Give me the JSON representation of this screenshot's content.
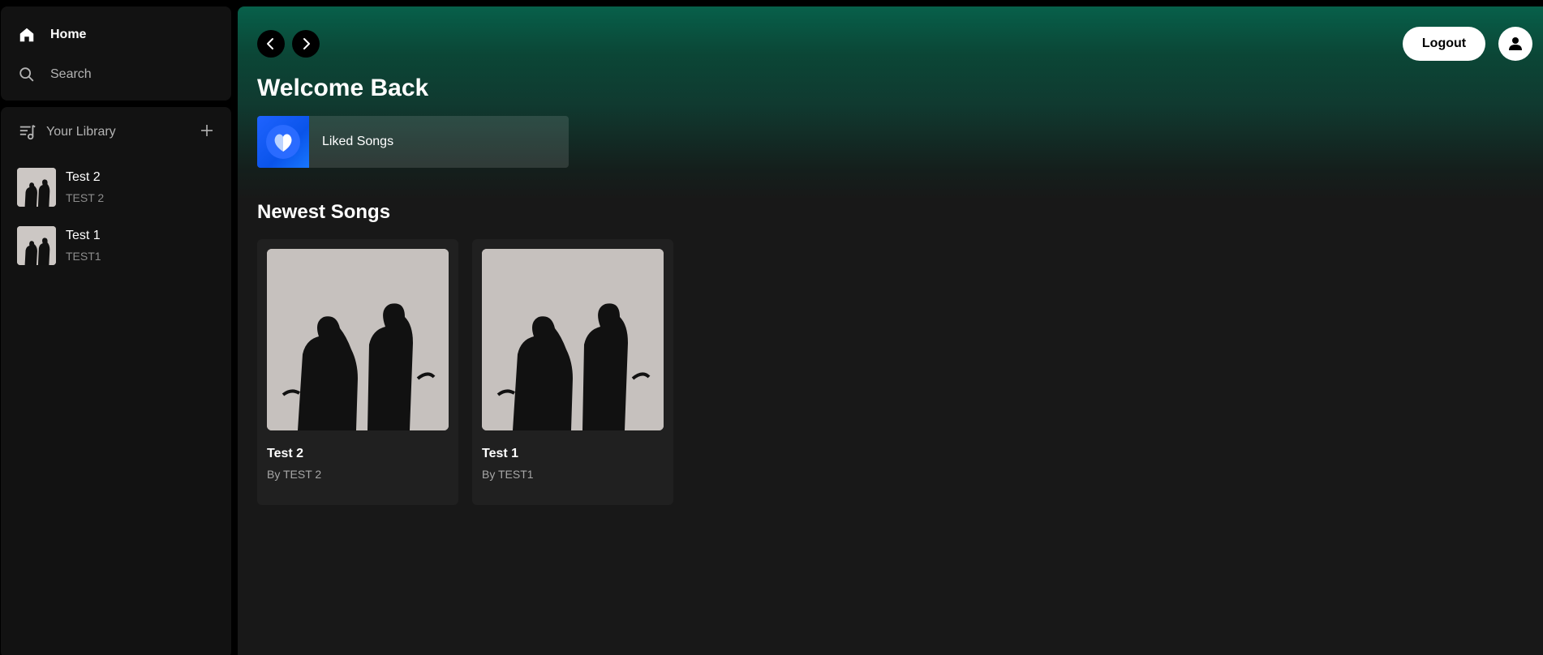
{
  "sidebar": {
    "nav": {
      "home_label": "Home",
      "search_label": "Search"
    },
    "library": {
      "label": "Your Library",
      "items": [
        {
          "title": "Test 2",
          "artist": "TEST 2"
        },
        {
          "title": "Test 1",
          "artist": "TEST1"
        }
      ]
    }
  },
  "header": {
    "logout_label": "Logout"
  },
  "main": {
    "welcome": "Welcome Back",
    "liked_songs_label": "Liked Songs",
    "newest_title": "Newest Songs",
    "songs": [
      {
        "title": "Test 2",
        "by": "By TEST 2"
      },
      {
        "title": "Test 1",
        "by": "By TEST1"
      }
    ]
  },
  "colors": {
    "accent_green": "#07604a",
    "liked_blue": "#1f63ff",
    "background": "#121212"
  },
  "icons": [
    "home-icon",
    "search-icon",
    "library-icon",
    "plus-icon",
    "chevron-left-icon",
    "chevron-right-icon",
    "user-icon",
    "heart-icon"
  ]
}
